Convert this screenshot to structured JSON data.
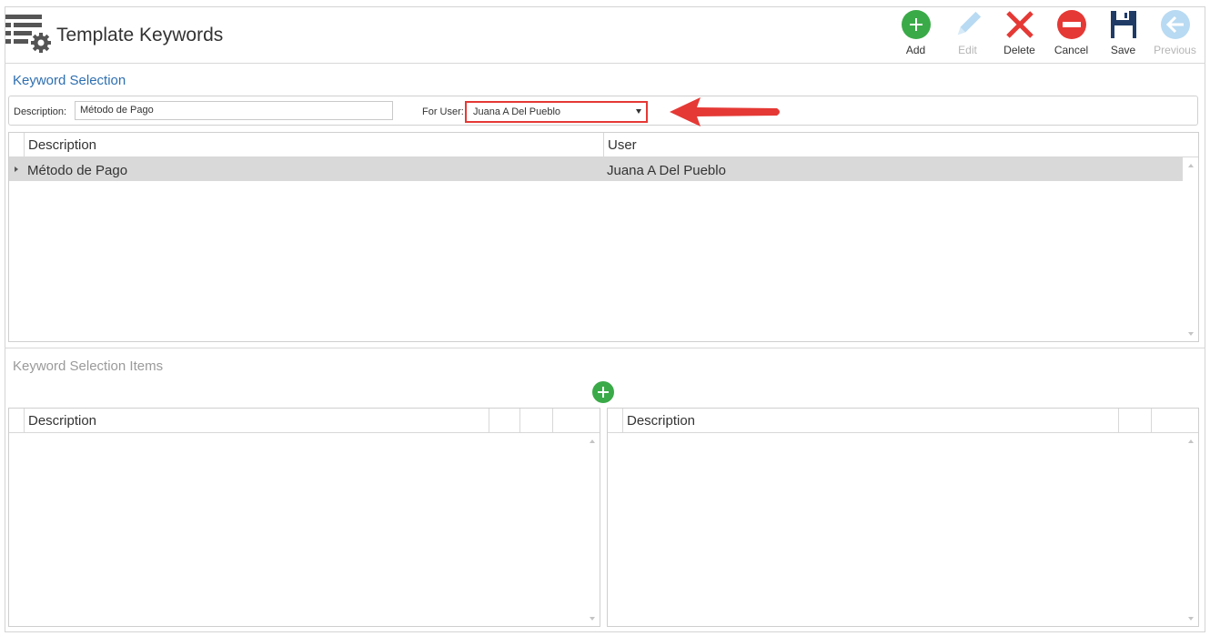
{
  "header": {
    "title": "Template Keywords"
  },
  "toolbar": {
    "add": "Add",
    "edit": "Edit",
    "delete": "Delete",
    "cancel": "Cancel",
    "save": "Save",
    "previous": "Previous"
  },
  "keyword_selection": {
    "title": "Keyword Selection",
    "description_label": "Description:",
    "description_value": "Método de Pago",
    "for_user_label": "For User:",
    "for_user_value": "Juana A Del Pueblo",
    "columns": [
      "Description",
      "User"
    ],
    "rows": [
      {
        "description": "Método de Pago",
        "user": "Juana A Del Pueblo"
      }
    ]
  },
  "keyword_selection_items": {
    "title": "Keyword Selection Items",
    "left_columns": [
      "Description"
    ],
    "right_columns": [
      "Description"
    ]
  },
  "colors": {
    "accent_blue": "#2e6fb0",
    "add_green": "#3aaa48",
    "delete_red": "#e53935",
    "selected_row": "#d9d9d9"
  }
}
